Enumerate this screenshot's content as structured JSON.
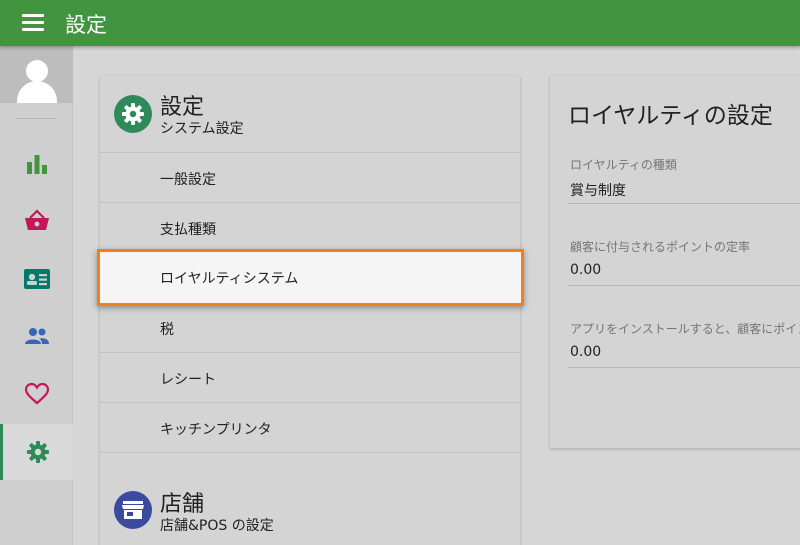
{
  "header": {
    "title": "設定"
  },
  "settings_section": {
    "title": "設定",
    "subtitle": "システム設定",
    "items": [
      {
        "label": "一般設定"
      },
      {
        "label": "支払種類"
      },
      {
        "label": "ロイヤルティシステム"
      },
      {
        "label": "税"
      },
      {
        "label": "レシート"
      },
      {
        "label": "キッチンプリンタ"
      }
    ]
  },
  "store_section": {
    "title": "店舗",
    "subtitle": "店舗&POS の設定"
  },
  "loyalty_panel": {
    "title": "ロイヤルティの設定",
    "fields": [
      {
        "label": "ロイヤルティの種類",
        "value": "賞与制度"
      },
      {
        "label": "顧客に付与されるポイントの定率",
        "value": "0.00"
      },
      {
        "label": "アプリをインストールすると、顧客にポイン",
        "value": "0.00"
      }
    ]
  },
  "sidebar": {
    "items": [
      {
        "icon": "bar-chart-icon",
        "color": "#43943f"
      },
      {
        "icon": "basket-icon",
        "color": "#c2185b"
      },
      {
        "icon": "contact-card-icon",
        "color": "#00796b"
      },
      {
        "icon": "people-icon",
        "color": "#3567b5"
      },
      {
        "icon": "heart-icon",
        "color": "#c2185b"
      },
      {
        "icon": "gear-icon",
        "color": "#2f8a5a",
        "active": true
      }
    ]
  },
  "colors": {
    "header": "#43943f",
    "highlight_border": "#f07f1e"
  }
}
